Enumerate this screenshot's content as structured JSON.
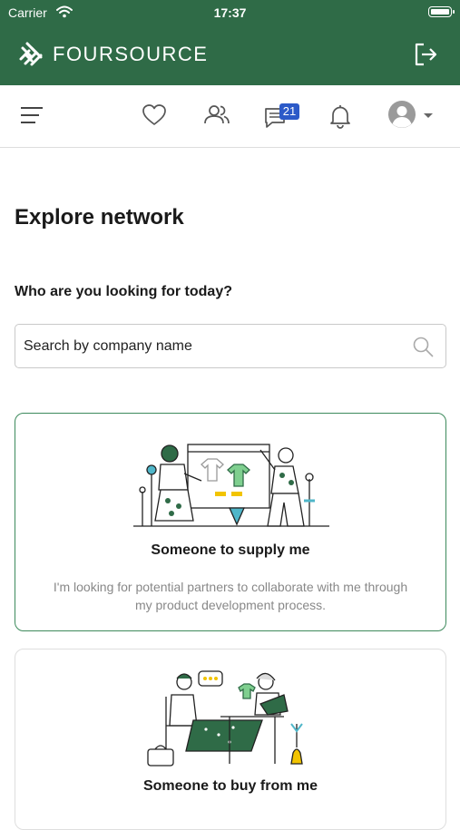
{
  "status_bar": {
    "carrier": "Carrier",
    "time": "17:37"
  },
  "header": {
    "brand": "FOURSOURCE",
    "bg_color": "#2f6b47"
  },
  "toolbar": {
    "message_count": "21"
  },
  "page": {
    "title": "Explore network",
    "question": "Who are you looking for today?",
    "search_placeholder": "Search by company name"
  },
  "cards": [
    {
      "title": "Someone to supply me",
      "description": "I'm looking for potential partners to collaborate with me through my product development process."
    },
    {
      "title": "Someone to buy from me"
    }
  ],
  "colors": {
    "accent_green": "#3d8a5c",
    "badge_blue": "#2c5ac8"
  }
}
